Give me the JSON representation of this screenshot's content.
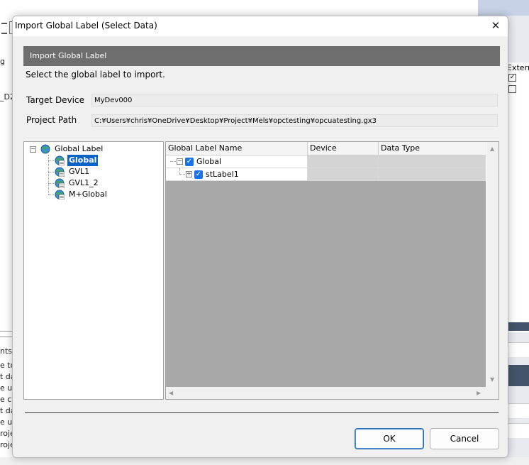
{
  "background": {
    "left_fragments": [
      "g",
      "_D2",
      "nts",
      "e to",
      "t da",
      "e up",
      "e cy",
      "t da",
      "e up",
      "roje",
      "roje"
    ],
    "right_label": "Externa"
  },
  "dialog": {
    "title": "Import Global Label (Select Data)",
    "close_glyph": "✕",
    "banner": "Import Global Label",
    "instruction": "Select the global label to import.",
    "target_device_label": "Target Device",
    "target_device_value": "MyDev000",
    "project_path_label": "Project Path",
    "project_path_value": "C:¥Users¥chris¥OneDrive¥Desktop¥Project¥Mels¥opctesting¥opcuatesting.gx3",
    "tree": {
      "root": "Global Label",
      "items": [
        "Global",
        "GVL1",
        "GVL1_2",
        "M+Global"
      ],
      "selected": "Global",
      "expander_minus": "−"
    },
    "grid": {
      "columns": [
        "Global Label Name",
        "Device",
        "Data Type"
      ],
      "rows": [
        {
          "name": "Global",
          "checked": "✓",
          "expander": "−",
          "device": "",
          "data_type": ""
        },
        {
          "name": "stLabel1",
          "checked": "✓",
          "expander": "+",
          "device": "",
          "data_type": ""
        }
      ]
    },
    "buttons": {
      "ok": "OK",
      "cancel": "Cancel"
    }
  },
  "icons": {
    "globe": "globe-icon",
    "close": "close-icon",
    "checkbox": "check-icon"
  },
  "colors": {
    "selection": "#0a64c8",
    "checkbox": "#1a73e8",
    "banner": "#6e6e6e",
    "grid_empty": "#a8a8a8"
  }
}
